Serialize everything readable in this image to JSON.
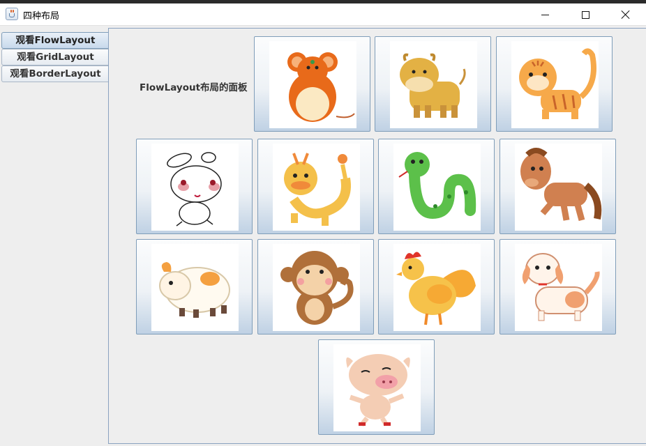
{
  "window": {
    "title": "四种布局"
  },
  "tabs": [
    {
      "label": "观看FlowLayout",
      "selected": true
    },
    {
      "label": "观看GridLayout",
      "selected": false
    },
    {
      "label": "观看BorderLayout",
      "selected": false
    }
  ],
  "panel": {
    "label": "FlowLayout布局的面板"
  },
  "buttons": [
    {
      "icon": "mouse-icon"
    },
    {
      "icon": "ox-icon"
    },
    {
      "icon": "tiger-icon"
    },
    {
      "icon": "rabbit-icon"
    },
    {
      "icon": "dragon-icon"
    },
    {
      "icon": "snake-icon"
    },
    {
      "icon": "horse-icon"
    },
    {
      "icon": "sheep-icon"
    },
    {
      "icon": "monkey-icon"
    },
    {
      "icon": "rooster-icon"
    },
    {
      "icon": "dog-icon"
    },
    {
      "icon": "pig-icon"
    }
  ]
}
